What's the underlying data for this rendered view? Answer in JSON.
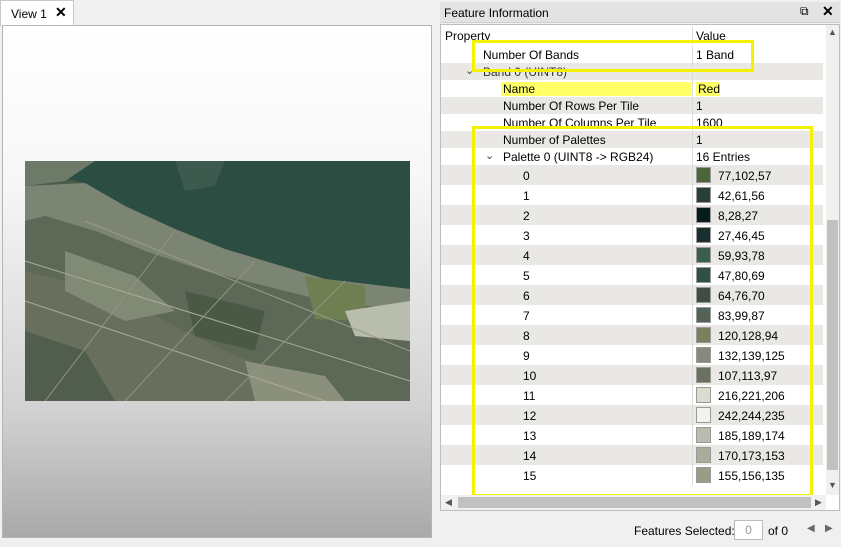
{
  "view_tab": {
    "label": "View 1",
    "close_icon": "close-icon"
  },
  "panel": {
    "title": "Feature Information",
    "float_icon": "float-icon",
    "close_icon": "close-icon",
    "header": {
      "property": "Property",
      "value": "Value"
    }
  },
  "rows": {
    "bands": {
      "label": "Number Of Bands",
      "value": "1 Band"
    },
    "band0": {
      "label": "Band 0 (UINT8)"
    },
    "name": {
      "label": "Name",
      "value": "Red"
    },
    "rows_per_tile": {
      "label": "Number Of Rows Per Tile",
      "value": "1"
    },
    "cols_per_tile": {
      "label": "Number Of Columns Per Tile",
      "value": "1600"
    },
    "num_palettes": {
      "label": "Number of Palettes",
      "value": "1"
    },
    "palette0": {
      "label": "Palette 0 (UINT8 -> RGB24)",
      "value": "16 Entries"
    }
  },
  "palette": [
    {
      "index": "0",
      "rgb": "77,102,57",
      "color": "#4d6639"
    },
    {
      "index": "1",
      "rgb": "42,61,56",
      "color": "#2a3d38"
    },
    {
      "index": "2",
      "rgb": "8,28,27",
      "color": "#081c1b"
    },
    {
      "index": "3",
      "rgb": "27,46,45",
      "color": "#1b2e2d"
    },
    {
      "index": "4",
      "rgb": "59,93,78",
      "color": "#3b5d4e"
    },
    {
      "index": "5",
      "rgb": "47,80,69",
      "color": "#2f5045"
    },
    {
      "index": "6",
      "rgb": "64,76,70",
      "color": "#404c46"
    },
    {
      "index": "7",
      "rgb": "83,99,87",
      "color": "#536357"
    },
    {
      "index": "8",
      "rgb": "120,128,94",
      "color": "#78805e"
    },
    {
      "index": "9",
      "rgb": "132,139,125",
      "color": "#848b7d"
    },
    {
      "index": "10",
      "rgb": "107,113,97",
      "color": "#6b7161"
    },
    {
      "index": "11",
      "rgb": "216,221,206",
      "color": "#d8ddce"
    },
    {
      "index": "12",
      "rgb": "242,244,235",
      "color": "#f2f4eb"
    },
    {
      "index": "13",
      "rgb": "185,189,174",
      "color": "#b9bdae"
    },
    {
      "index": "14",
      "rgb": "170,173,153",
      "color": "#aaad99"
    },
    {
      "index": "15",
      "rgb": "155,156,135",
      "color": "#9b9c87"
    }
  ],
  "footer": {
    "features_selected_label": "Features Selected:",
    "selected_count": "0",
    "of_label": "of 0"
  },
  "colors": {
    "highlight": "#ffff66",
    "annotation": "#f3f300"
  }
}
